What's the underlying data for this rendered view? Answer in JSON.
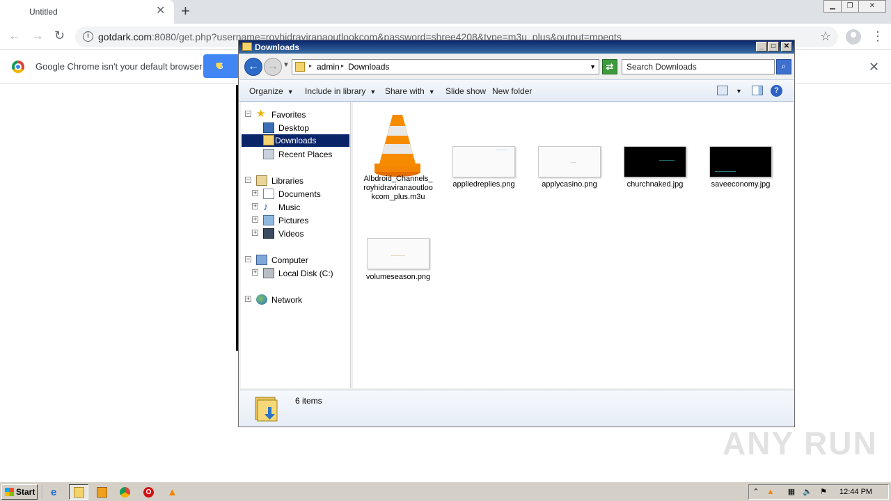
{
  "browser": {
    "tab_title": "Untitled",
    "url_host": "gotdark.com",
    "url_rest": ":8080/get.php?username=royhidraviranaoutlookcom&password=shree4208&type=m3u_plus&output=mpegts",
    "infobar_message": "Google Chrome isn't your default browser",
    "infobar_button": "S"
  },
  "explorer": {
    "title": "Downloads",
    "breadcrumb": [
      "admin",
      "Downloads"
    ],
    "search_placeholder": "Search Downloads",
    "commands": {
      "organize": "Organize",
      "include_in_library": "Include in library",
      "share_with": "Share with",
      "slide_show": "Slide show",
      "new_folder": "New folder"
    },
    "nav": {
      "favorites": "Favorites",
      "desktop": "Desktop",
      "downloads": "Downloads",
      "recent_places": "Recent Places",
      "libraries": "Libraries",
      "documents": "Documents",
      "music": "Music",
      "pictures": "Pictures",
      "videos": "Videos",
      "computer": "Computer",
      "local_disk": "Local Disk (C:)",
      "network": "Network"
    },
    "files": [
      {
        "name": "Albdroid_Channels_royhidraviranaoutlookcom_plus.m3u",
        "type": "vlc"
      },
      {
        "name": "appliedreplies.png",
        "type": "light"
      },
      {
        "name": "applycasino.png",
        "type": "light"
      },
      {
        "name": "churchnaked.jpg",
        "type": "dark"
      },
      {
        "name": "saveeconomy.jpg",
        "type": "dark"
      },
      {
        "name": "volumeseason.png",
        "type": "light"
      }
    ],
    "item_count": "6 items"
  },
  "taskbar": {
    "start_label": "Start",
    "clock": "12:44 PM"
  },
  "watermark": "ANY RUN",
  "colors": {
    "selection": "#0a246a",
    "title_bar": "#0a246a",
    "chrome_blue": "#4285f4"
  }
}
